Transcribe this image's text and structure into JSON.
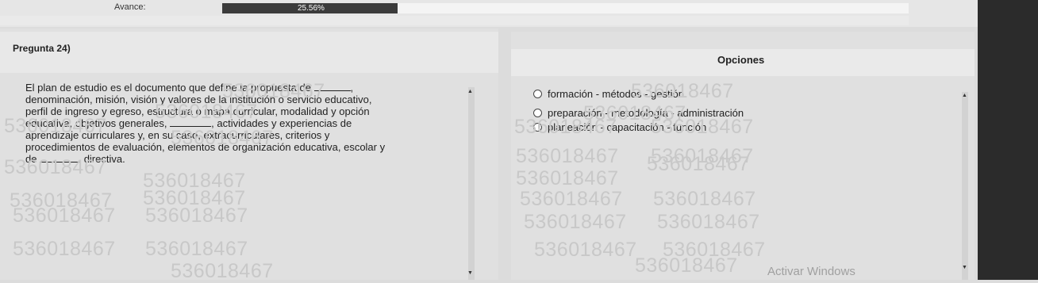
{
  "progress": {
    "label": "Avance:",
    "percent_text": "25.56%",
    "fraction": 0.2556
  },
  "question": {
    "title": "Pregunta 24)",
    "lines": [
      [
        "El plan de estudio es el documento que define la propuesta de ",
        "blank",
        ","
      ],
      [
        "denominación, misión, visión y valores de la institución o servicio educativo,"
      ],
      [
        "perfil de ingreso y egreso, estructura o mapa curricular, modalidad y opción"
      ],
      [
        "educativa, objetivos generales, ",
        "blank",
        ", actividades y experiencias de"
      ],
      [
        "aprendizaje curriculares y, en su caso, extracurriculares, criterios y"
      ],
      [
        "procedimientos de evaluación, elementos de organización educativa, escolar y"
      ],
      [
        "de ",
        "blank",
        " directiva."
      ]
    ]
  },
  "options": {
    "title": "Opciones",
    "items": [
      "formación - métodos - gestión",
      "preparación - metodología - administración",
      "planeación - capacitación - función"
    ]
  },
  "watermark": {
    "text": "536018467"
  },
  "system": {
    "activate_windows": "Activar Windows"
  }
}
